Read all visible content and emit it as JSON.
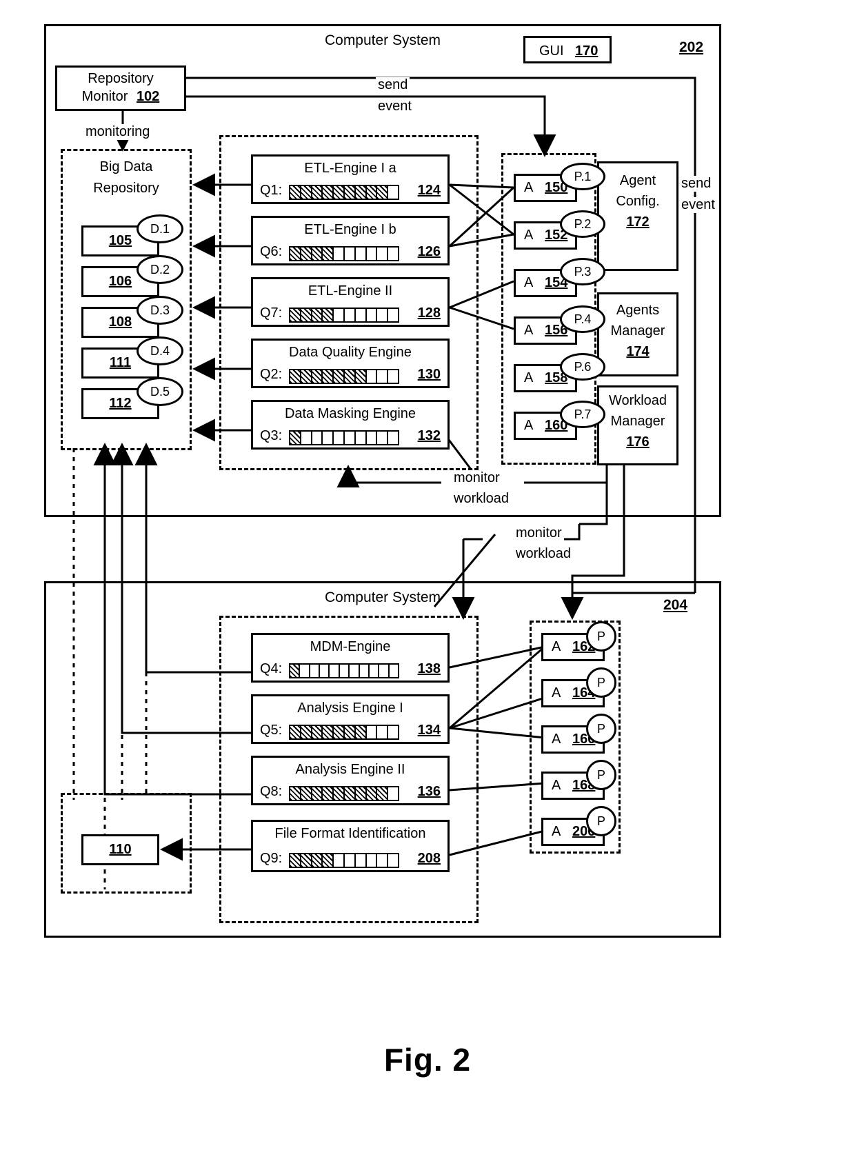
{
  "figure": {
    "caption": "Fig. 2"
  },
  "system_top": {
    "title": "Computer System",
    "ref": "202",
    "gui": {
      "label": "GUI",
      "ref": "170"
    },
    "repository_monitor": {
      "line1": "Repository",
      "line2": "Monitor",
      "ref": "102"
    },
    "edge_labels": {
      "monitoring": "monitoring",
      "send_event_top": "send\nevent",
      "send_event_right": "send\nevent",
      "monitor_workload": "monitor\nworkload"
    },
    "big_data_repository": {
      "title_line1": "Big Data",
      "title_line2": "Repository",
      "items": [
        {
          "ref": "105",
          "tag": "D.1"
        },
        {
          "ref": "106",
          "tag": "D.2"
        },
        {
          "ref": "108",
          "tag": "D.3"
        },
        {
          "ref": "111",
          "tag": "D.4"
        },
        {
          "ref": "112",
          "tag": "D.5"
        }
      ]
    },
    "engines": [
      {
        "name": "ETL-Engine I a",
        "queue": "Q1:",
        "ref": "124",
        "cells": 10,
        "filled": 9
      },
      {
        "name": "ETL-Engine I b",
        "queue": "Q6:",
        "ref": "126",
        "cells": 10,
        "filled": 4
      },
      {
        "name": "ETL-Engine II",
        "queue": "Q7:",
        "ref": "128",
        "cells": 10,
        "filled": 4
      },
      {
        "name": "Data Quality Engine",
        "queue": "Q2:",
        "ref": "130",
        "cells": 10,
        "filled": 7
      },
      {
        "name": "Data Masking Engine",
        "queue": "Q3:",
        "ref": "132",
        "cells": 10,
        "filled": 1
      }
    ],
    "agents": [
      {
        "label": "A",
        "ref": "150",
        "port": "P.1"
      },
      {
        "label": "A",
        "ref": "152",
        "port": "P.2"
      },
      {
        "label": "A",
        "ref": "154",
        "port": "P.3"
      },
      {
        "label": "A",
        "ref": "156",
        "port": "P.4"
      },
      {
        "label": "A",
        "ref": "158",
        "port": "P.6"
      },
      {
        "label": "A",
        "ref": "160",
        "port": "P.7"
      }
    ],
    "managers": [
      {
        "line1": "Agent",
        "line2": "Config.",
        "ref": "172"
      },
      {
        "line1": "Agents",
        "line2": "Manager",
        "ref": "174"
      },
      {
        "line1": "Workload",
        "line2": "Manager",
        "ref": "176"
      }
    ]
  },
  "system_bottom": {
    "title": "Computer System",
    "ref": "204",
    "edge_labels": {
      "monitor_workload": "monitor\nworkload"
    },
    "store": {
      "ref": "110"
    },
    "engines": [
      {
        "name": "MDM-Engine",
        "queue": "Q4:",
        "ref": "138",
        "cells": 11,
        "filled": 1
      },
      {
        "name": "Analysis Engine I",
        "queue": "Q5:",
        "ref": "134",
        "cells": 10,
        "filled": 7
      },
      {
        "name": "Analysis Engine II",
        "queue": "Q8:",
        "ref": "136",
        "cells": 10,
        "filled": 9
      },
      {
        "name": "File Format Identification",
        "queue": "Q9:",
        "ref": "208",
        "cells": 10,
        "filled": 4
      }
    ],
    "agents": [
      {
        "label": "A",
        "ref": "162",
        "port": "P"
      },
      {
        "label": "A",
        "ref": "164",
        "port": "P"
      },
      {
        "label": "A",
        "ref": "166",
        "port": "P"
      },
      {
        "label": "A",
        "ref": "168",
        "port": "P"
      },
      {
        "label": "A",
        "ref": "206",
        "port": "P"
      }
    ]
  }
}
